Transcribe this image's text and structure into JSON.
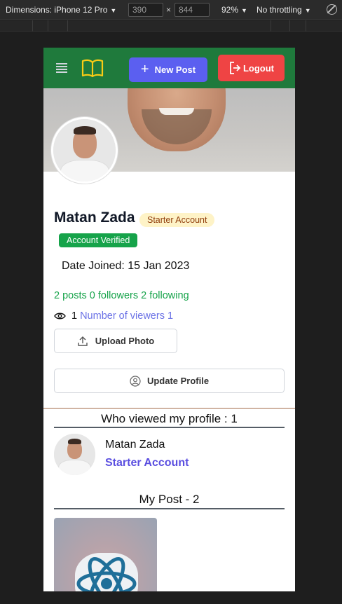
{
  "devtools": {
    "dimensions_label": "Dimensions: iPhone 12 Pro",
    "width": "390",
    "height": "844",
    "times": "×",
    "zoom": "92%",
    "throttling": "No throttling"
  },
  "navbar": {
    "new_post_label": "New Post",
    "logout_label": "Logout",
    "colors": {
      "bar": "#1f7a3c",
      "new_post": "#5b5ff0",
      "logout": "#ef4444"
    }
  },
  "profile": {
    "name": "Matan Zada",
    "account_type": "Starter Account",
    "verified_label": "Account Verified",
    "date_joined": "Date Joined: 15 Jan 2023",
    "stats": "2 posts 0 followers 2 following",
    "view_count": "1",
    "viewers_link": "Number of viewers 1",
    "upload_label": "Upload Photo",
    "update_label": "Update Profile"
  },
  "viewers_section": {
    "title": "Who viewed my profile : 1",
    "items": [
      {
        "name": "Matan Zada",
        "account": "Starter Account"
      }
    ]
  },
  "posts_section": {
    "title": "My Post - 2"
  }
}
